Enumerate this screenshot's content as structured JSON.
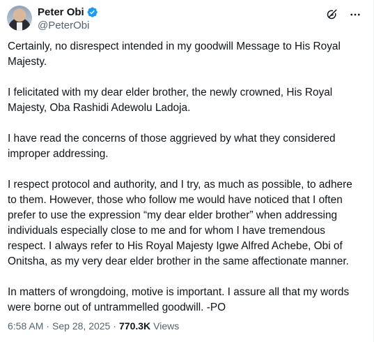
{
  "author": {
    "display_name": "Peter Obi",
    "handle": "@PeterObi",
    "verified": true
  },
  "actions": {
    "grok_icon": "grok-icon",
    "more_icon": "more-icon"
  },
  "paragraphs": [
    "Certainly, no disrespect intended in my goodwill Message to His Royal Majesty.",
    "I felicitated with my dear elder brother, the newly crowned, His Royal Majesty, Oba Rashidi Adewolu Ladoja.",
    "I have read the concerns of those aggrieved by what they considered improper addressing.",
    "I respect protocol and authority, and I try, as much as possible, to adhere to them. However, those who follow me would have noticed that I often prefer to use the expression “my dear elder brother” when addressing individuals especially close to me and for whom I have tremendous respect. I always refer to His Royal Majesty Igwe Alfred Achebe, Obi of Onitsha, as my very dear elder brother in the same affectionate manner.",
    "In matters of wrongdoing, motive is important. I assure all that my words were borne out of untrammelled goodwill. -PO"
  ],
  "meta": {
    "time": "6:58 AM",
    "separator": "·",
    "date": "Sep 28, 2025",
    "views_count": "770.3K",
    "views_label": "Views"
  },
  "colors": {
    "text": "#0f1419",
    "secondary": "#536471",
    "verified": "#1d9bf0"
  }
}
